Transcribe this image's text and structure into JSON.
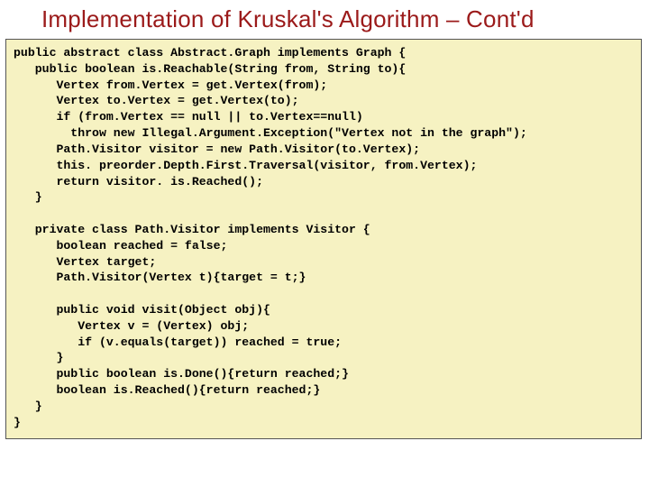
{
  "title": "Implementation of Kruskal's Algorithm – Cont'd",
  "code": "public abstract class Abstract.Graph implements Graph {\n   public boolean is.Reachable(String from, String to){\n      Vertex from.Vertex = get.Vertex(from);\n      Vertex to.Vertex = get.Vertex(to);\n      if (from.Vertex == null || to.Vertex==null)\n        throw new Illegal.Argument.Exception(\"Vertex not in the graph\");\n      Path.Visitor visitor = new Path.Visitor(to.Vertex);\n      this. preorder.Depth.First.Traversal(visitor, from.Vertex);\n      return visitor. is.Reached();\n   }\n\n   private class Path.Visitor implements Visitor {\n      boolean reached = false;\n      Vertex target;\n      Path.Visitor(Vertex t){target = t;}\n\n      public void visit(Object obj){\n         Vertex v = (Vertex) obj;\n         if (v.equals(target)) reached = true;\n      }\n      public boolean is.Done(){return reached;}\n      boolean is.Reached(){return reached;}\n   }\n}"
}
